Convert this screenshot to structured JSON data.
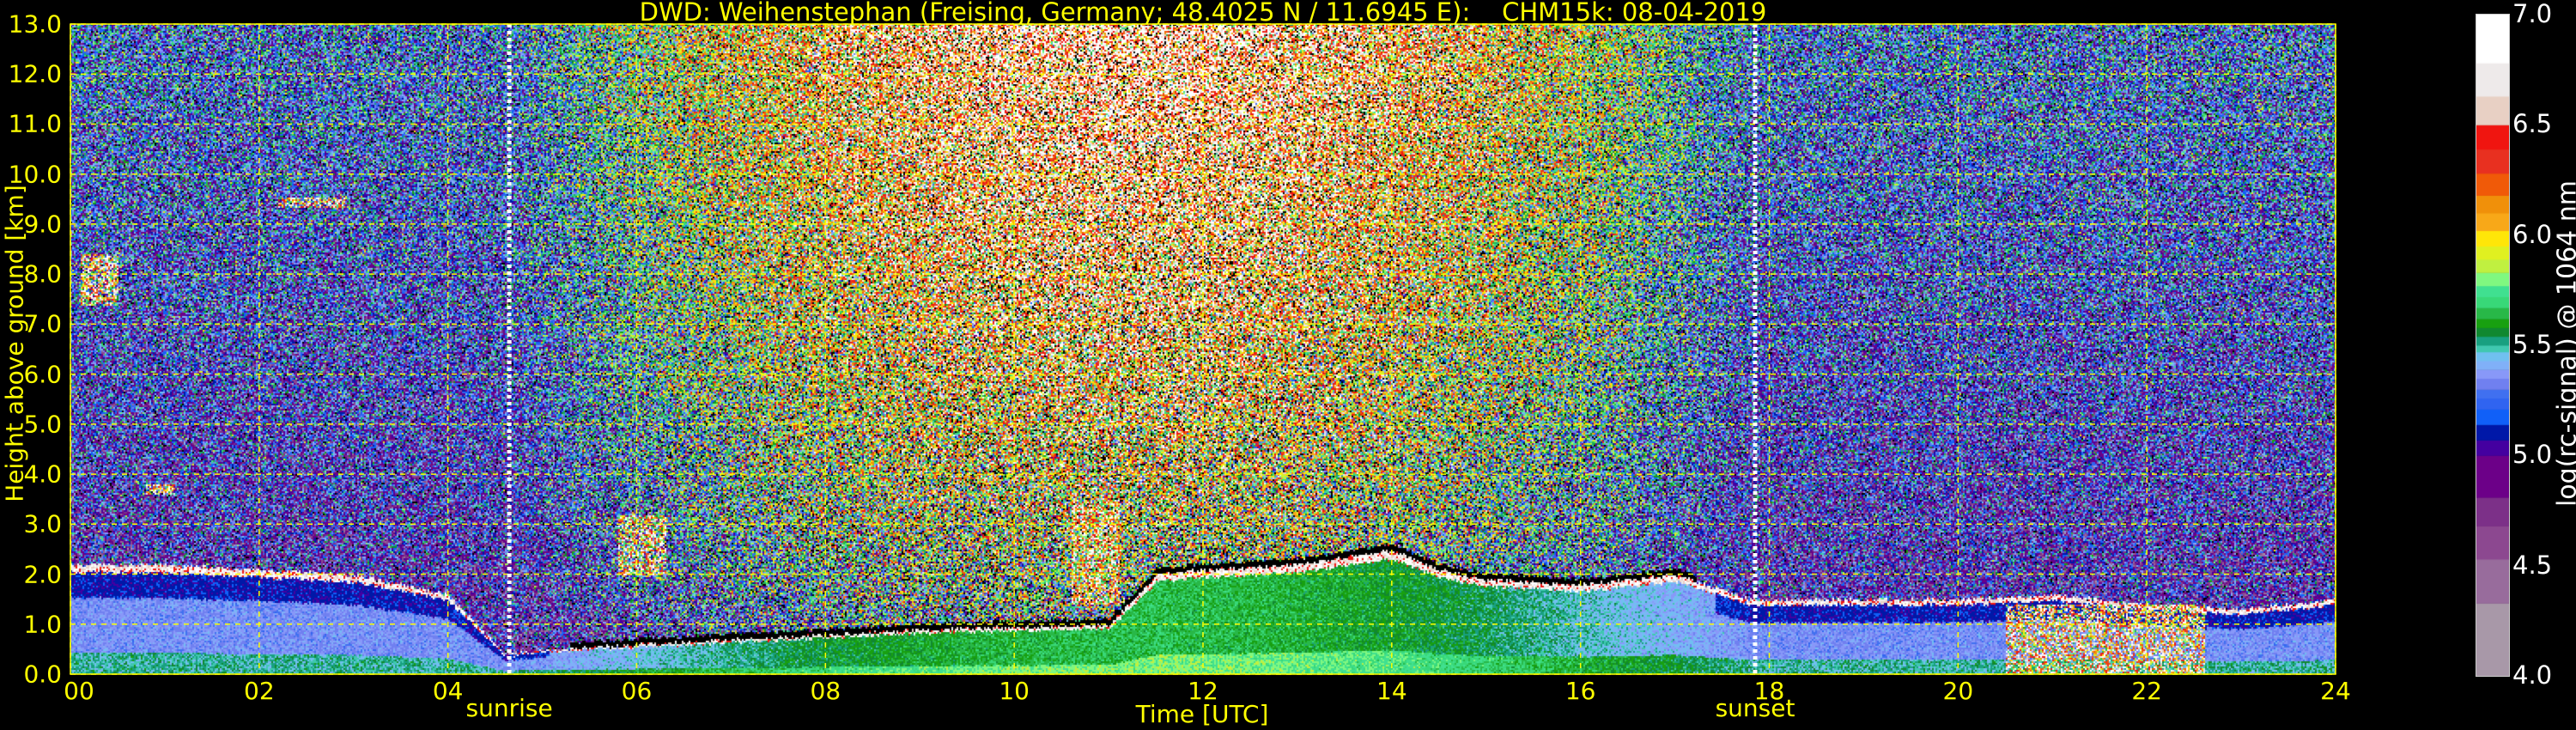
{
  "chart_data": {
    "type": "heatmap",
    "title": "DWD: Weihenstephan (Freising, Germany; 48.4025 N / 11.6945 E):    CHM15k: 08-04-2019",
    "xlabel": "Time [UTC]",
    "ylabel": "Height above ground [km]",
    "xlim": [
      0,
      24
    ],
    "ylim": [
      0,
      13
    ],
    "x_ticks": [
      {
        "value": 0,
        "label": "00"
      },
      {
        "value": 2,
        "label": "02"
      },
      {
        "value": 4,
        "label": "04"
      },
      {
        "value": 6,
        "label": "06"
      },
      {
        "value": 8,
        "label": "08"
      },
      {
        "value": 10,
        "label": "10"
      },
      {
        "value": 12,
        "label": "12"
      },
      {
        "value": 14,
        "label": "14"
      },
      {
        "value": 16,
        "label": "16"
      },
      {
        "value": 18,
        "label": "18"
      },
      {
        "value": 20,
        "label": "20"
      },
      {
        "value": 22,
        "label": "22"
      },
      {
        "value": 24,
        "label": "24"
      }
    ],
    "y_ticks": [
      "0.0",
      "1.0",
      "2.0",
      "3.0",
      "4.0",
      "5.0",
      "6.0",
      "7.0",
      "8.0",
      "9.0",
      "10.0",
      "11.0",
      "12.0",
      "13.0"
    ],
    "grid": true,
    "grid_color": "#ffff00",
    "annotations": [
      {
        "label": "sunrise",
        "x": 4.65
      },
      {
        "label": "sunset",
        "x": 17.85
      }
    ],
    "colorbar": {
      "label": "log(rc-signal) @ 1064 nm",
      "range": [
        4.0,
        7.0
      ],
      "ticks": [
        "4.0",
        "4.5",
        "5.0",
        "5.5",
        "6.0",
        "6.5",
        "7.0"
      ],
      "bands": [
        {
          "from": 4.0,
          "color": "#a898a8"
        },
        {
          "from": 4.33,
          "color": "#986c9c"
        },
        {
          "from": 4.53,
          "color": "#8c4890"
        },
        {
          "from": 4.68,
          "color": "#7c3088"
        },
        {
          "from": 4.81,
          "color": "#6c0088"
        },
        {
          "from": 5.0,
          "color": "#4400a0"
        },
        {
          "from": 5.07,
          "color": "#0018a8"
        },
        {
          "from": 5.14,
          "color": "#1060f8"
        },
        {
          "from": 5.21,
          "color": "#3064f0"
        },
        {
          "from": 5.26,
          "color": "#4070f0"
        },
        {
          "from": 5.3,
          "color": "#7080f0"
        },
        {
          "from": 5.35,
          "color": "#8898f8"
        },
        {
          "from": 5.39,
          "color": "#80b0f8"
        },
        {
          "from": 5.43,
          "color": "#70c0f0"
        },
        {
          "from": 5.47,
          "color": "#40c8b0"
        },
        {
          "from": 5.5,
          "color": "#18a080"
        },
        {
          "from": 5.54,
          "color": "#108830"
        },
        {
          "from": 5.58,
          "color": "#18a010"
        },
        {
          "from": 5.62,
          "color": "#28b848"
        },
        {
          "from": 5.67,
          "color": "#38d878"
        },
        {
          "from": 5.72,
          "color": "#40e090"
        },
        {
          "from": 5.77,
          "color": "#80f880"
        },
        {
          "from": 5.83,
          "color": "#c0f040"
        },
        {
          "from": 5.89,
          "color": "#e0f020"
        },
        {
          "from": 5.95,
          "color": "#ffe608"
        },
        {
          "from": 6.02,
          "color": "#f8a818"
        },
        {
          "from": 6.1,
          "color": "#f0900a"
        },
        {
          "from": 6.18,
          "color": "#f05a08"
        },
        {
          "from": 6.28,
          "color": "#e83020"
        },
        {
          "from": 6.39,
          "color": "#f01510"
        },
        {
          "from": 6.5,
          "color": "#e8d0c4"
        },
        {
          "from": 6.63,
          "color": "#eeeaea"
        },
        {
          "from": 6.78,
          "color": "#ffffff"
        }
      ]
    },
    "aerosol_layer_top_km": {
      "time": [
        0,
        1,
        2,
        3,
        4,
        4.6,
        5,
        6,
        7,
        8,
        9,
        10,
        11,
        11.5,
        12,
        13,
        14,
        14.5,
        15,
        16,
        17,
        17.8,
        18,
        19,
        20,
        21,
        22,
        23,
        24
      ],
      "height": [
        2.2,
        2.2,
        2.1,
        2.0,
        1.6,
        0.4,
        0.5,
        0.6,
        0.7,
        0.8,
        0.9,
        0.95,
        1.0,
        2.0,
        2.1,
        2.2,
        2.5,
        2.1,
        1.9,
        1.8,
        2.0,
        1.5,
        1.5,
        1.5,
        1.5,
        1.6,
        1.4,
        1.3,
        1.5
      ]
    },
    "cloud_features": [
      {
        "t0": 0.1,
        "t1": 0.5,
        "h0": 7.4,
        "h1": 8.4
      },
      {
        "t0": 2.2,
        "t1": 2.9,
        "h0": 9.35,
        "h1": 9.55
      },
      {
        "t0": 0.8,
        "t1": 1.1,
        "h0": 3.6,
        "h1": 3.8
      },
      {
        "t0": 5.8,
        "t1": 6.3,
        "h0": 2.0,
        "h1": 3.2
      },
      {
        "t0": 10.6,
        "t1": 11.1,
        "h0": 1.4,
        "h1": 3.5
      },
      {
        "t0": 20.5,
        "t1": 22.6,
        "h0": 0.0,
        "h1": 1.4
      }
    ]
  }
}
